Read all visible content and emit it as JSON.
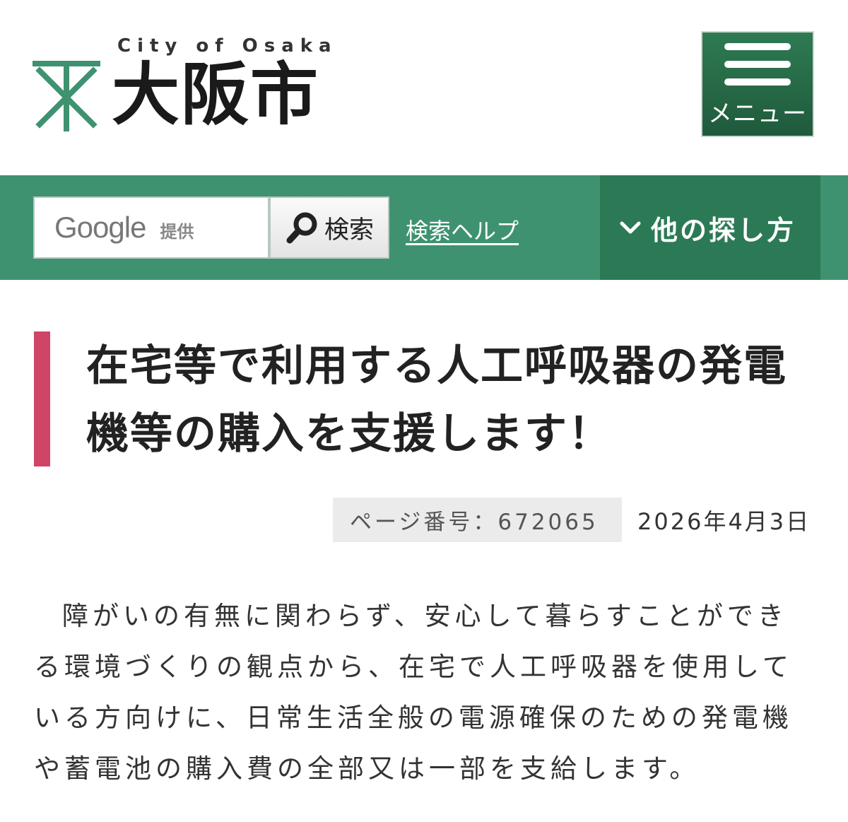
{
  "header": {
    "logo_sub": "City of Osaka",
    "logo_main": "大阪市",
    "menu_label": "メニュー"
  },
  "search": {
    "provider": "Google",
    "provider_sub": "提供",
    "button_label": "検索",
    "help_link": "検索ヘルプ",
    "other_ways": "他の探し方"
  },
  "article": {
    "title": "在宅等で利用する人工呼吸器の発電機等の購入を支援します！",
    "page_number": "ページ番号：672065",
    "date": "2026年4月3日",
    "body": "障がいの有無に関わらず、安心して暮らすことができる環境づくりの観点から、在宅で人工呼吸器を使用している方向けに、日常生活全般の電源確保のための発電機や蓄電池の購入費の全部又は一部を支給します。"
  },
  "colors": {
    "brand_green": "#3f9270",
    "dark_green": "#2c7a55",
    "title_accent": "#d04466"
  },
  "icons": [
    "osaka-emblem-icon",
    "hamburger-icon",
    "magnifier-icon",
    "chevron-down-icon"
  ]
}
